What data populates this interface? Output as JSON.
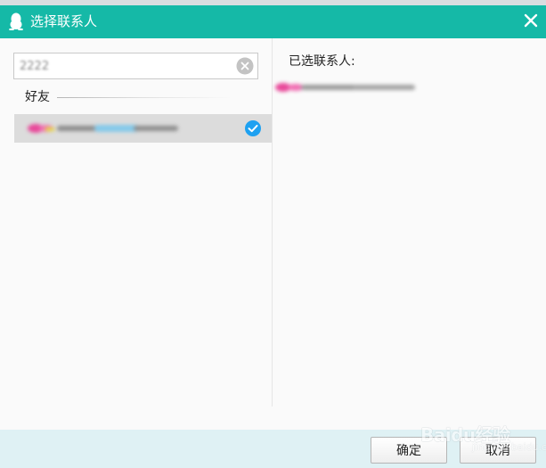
{
  "window": {
    "title": "选择联系人",
    "icons": {
      "app": "qq-penguin-icon",
      "close": "close-icon"
    },
    "colors": {
      "titlebar": "#15b9a7",
      "footer": "#dff1f4",
      "selected_row": "#dcdcdc",
      "check": "#1ea1f1"
    }
  },
  "search": {
    "value": "2222",
    "clear_icon": "clear-icon"
  },
  "contacts": {
    "group_label": "好友",
    "items": [
      {
        "name": "",
        "selected": true,
        "check_icon": "check-circle-icon"
      }
    ]
  },
  "selected_panel": {
    "label": "已选联系人:",
    "items": [
      {
        "name": ""
      }
    ]
  },
  "footer": {
    "confirm_label": "确定",
    "cancel_label": "取消"
  },
  "watermark": {
    "text": "Baidu经验",
    "sub": "jingyan.baidu.com"
  }
}
